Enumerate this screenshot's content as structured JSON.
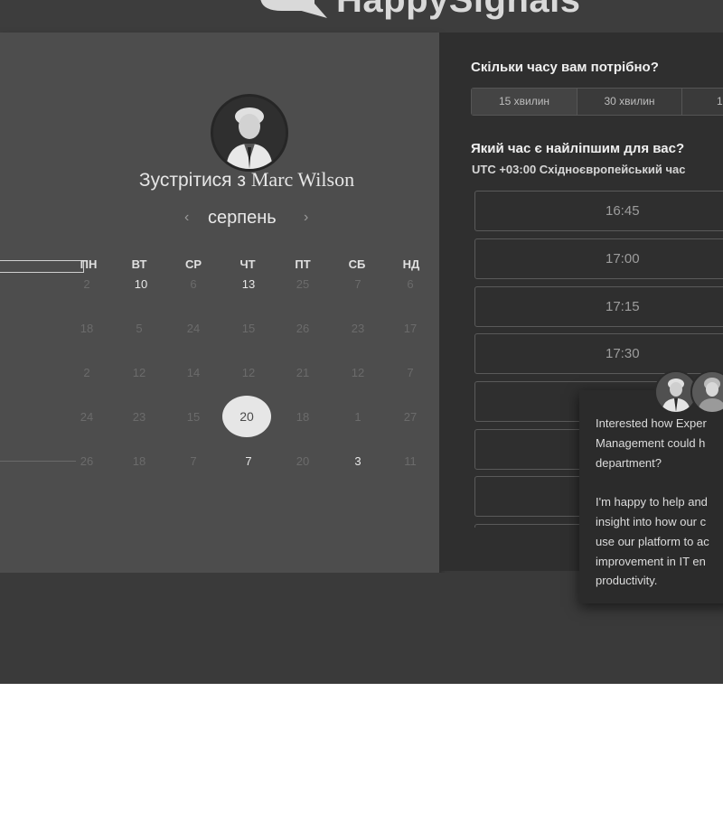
{
  "brand": {
    "name": "HappySignals"
  },
  "meeting": {
    "title_prefix": "Зустрітися з",
    "host": "Marc Wilson"
  },
  "calendar": {
    "month": "серпень",
    "weekdays": [
      "ПН",
      "ВТ",
      "СР",
      "ЧТ",
      "ПТ",
      "СБ",
      "НД"
    ],
    "rows": [
      [
        "2",
        "10",
        "6",
        "13",
        "25",
        "7",
        "6"
      ],
      [
        "18",
        "5",
        "24",
        "15",
        "26",
        "23",
        "17"
      ],
      [
        "2",
        "12",
        "14",
        "12",
        "21",
        "12",
        "7"
      ],
      [
        "24",
        "23",
        "15",
        "20",
        "18",
        "1",
        "27"
      ],
      [
        "26",
        "18",
        "7",
        "7",
        "20",
        "3",
        "11"
      ]
    ],
    "selected": "20"
  },
  "booking": {
    "duration_label": "Скільки часу вам потрібно?",
    "durations": [
      "15 хвилин",
      "30 хвилин",
      "1"
    ],
    "time_label": "Який час є найліпшим для вас?",
    "timezone": "UTC +03:00 Східноєвропейський час",
    "slots": [
      "16:45",
      "17:00",
      "17:15",
      "17:30",
      "",
      "",
      "",
      ""
    ]
  },
  "chat": {
    "message": "Interested how Exper\nManagement could h\ndepartment?\n\nI'm happy to help and\ninsight into how our c\nuse our platform to ac\nimprovement in IT en\nproductivity."
  },
  "colors": {
    "background": "#3a3a3a",
    "panel": "#4d4d4d",
    "right_panel": "#2f2f2f",
    "selected_day": "#e6e6e6"
  }
}
